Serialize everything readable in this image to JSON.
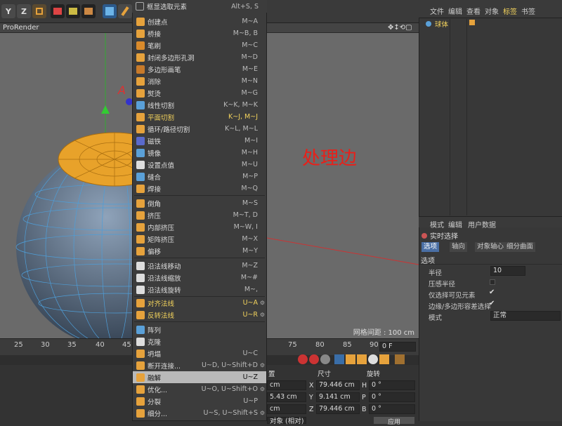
{
  "viewport": {
    "title": "ProRender",
    "grid_spacing": "网格间距 : 100 cm",
    "annotation": "处理边",
    "axis_letter": "A"
  },
  "toolbar": {
    "btn_y": "Y",
    "btn_z": "Z"
  },
  "menu": {
    "header": {
      "label": "框显选取元素",
      "shortcut": "Alt+S, S"
    },
    "items": [
      {
        "label": "创建点",
        "shortcut": "M~A"
      },
      {
        "label": "桥接",
        "shortcut": "M~B, B"
      },
      {
        "label": "笔刷",
        "shortcut": "M~C"
      },
      {
        "label": "封闭多边形孔洞",
        "shortcut": "M~D"
      },
      {
        "label": "多边形画笔",
        "shortcut": "M~E"
      },
      {
        "label": "消除",
        "shortcut": "M~N"
      },
      {
        "label": "熨烫",
        "shortcut": "M~G"
      },
      {
        "label": "线性切割",
        "shortcut": "K~K, M~K"
      },
      {
        "label": "平面切割",
        "shortcut": "K~J, M~J"
      },
      {
        "label": "循环/路径切割",
        "shortcut": "K~L, M~L"
      },
      {
        "label": "磁铁",
        "shortcut": "M~I"
      },
      {
        "label": "镜像",
        "shortcut": "M~H"
      },
      {
        "label": "设置点值",
        "shortcut": "M~U"
      },
      {
        "label": "缝合",
        "shortcut": "M~P"
      },
      {
        "label": "焊接",
        "shortcut": "M~Q"
      },
      {
        "label": "倒角",
        "shortcut": "M~S"
      },
      {
        "label": "挤压",
        "shortcut": "M~T, D"
      },
      {
        "label": "内部挤压",
        "shortcut": "M~W, I"
      },
      {
        "label": "矩阵挤压",
        "shortcut": "M~X"
      },
      {
        "label": "偏移",
        "shortcut": "M~Y"
      },
      {
        "label": "沿法线移动",
        "shortcut": "M~Z"
      },
      {
        "label": "沿法线缩放",
        "shortcut": "M~#"
      },
      {
        "label": "沿法线旋转",
        "shortcut": "M~,"
      },
      {
        "label": "对齐法线",
        "shortcut": "U~A"
      },
      {
        "label": "反转法线",
        "shortcut": "U~R"
      },
      {
        "label": "阵列",
        "shortcut": ""
      },
      {
        "label": "克隆",
        "shortcut": ""
      },
      {
        "label": "坍塌",
        "shortcut": "U~C"
      },
      {
        "label": "断开连接...",
        "shortcut": "U~D, U~Shift+D"
      },
      {
        "label": "融解",
        "shortcut": "U~Z"
      },
      {
        "label": "优化...",
        "shortcut": "U~O, U~Shift+O"
      },
      {
        "label": "分裂",
        "shortcut": "U~P"
      },
      {
        "label": "细分...",
        "shortcut": "U~S, U~Shift+S"
      }
    ]
  },
  "objects_panel": {
    "menu": [
      "文件",
      "编辑",
      "查看",
      "对象",
      "标签",
      "书签"
    ],
    "object_name": "球体"
  },
  "attributes_panel": {
    "menu": [
      "模式",
      "编辑",
      "用户数据"
    ],
    "tool_name": "实时选择",
    "tabs": [
      "选项",
      "轴向",
      "对象轴心",
      "细分曲面"
    ],
    "section": "选项",
    "props": [
      {
        "label": "半径",
        "value": "10"
      },
      {
        "label": "压感半径",
        "value": ""
      },
      {
        "label": "仅选择可见元素",
        "value": "✔"
      },
      {
        "label": "边缘/多边形容差选择",
        "value": "✔"
      },
      {
        "label": "模式",
        "value": "正常"
      }
    ]
  },
  "timeline": {
    "ticks": [
      "25",
      "30",
      "35",
      "40",
      "45",
      "75",
      "80",
      "85",
      "90"
    ],
    "frame": "0 F"
  },
  "coords": {
    "header_pos": "置",
    "header_size": "尺寸",
    "header_rot": "旋转",
    "pos": [
      "cm",
      "5.43 cm",
      "cm"
    ],
    "size_labels": [
      "X",
      "Y",
      "Z"
    ],
    "size_values": [
      "79.446 cm",
      "9.141 cm",
      "79.446 cm"
    ],
    "rot_labels": [
      "H",
      "P",
      "B"
    ],
    "rot_values": [
      "0 °",
      "0 °",
      "0 °"
    ],
    "apply": "应用",
    "mode_hint": "对象 (相对)"
  },
  "colors": {
    "highlight": "#f2d25c",
    "annotation": "#e8201a",
    "selected_row": "#b9b9b9",
    "tab_active": "#4a6fa5"
  }
}
